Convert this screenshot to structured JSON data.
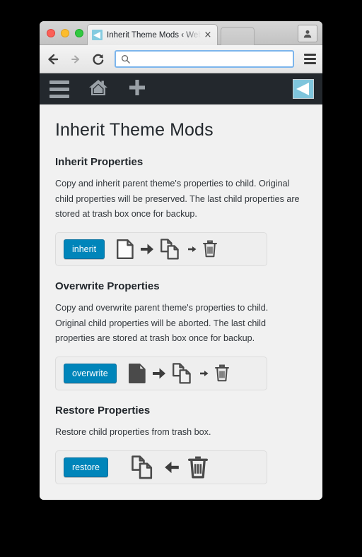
{
  "window": {
    "traffic_lights": [
      "close",
      "minimize",
      "maximize"
    ],
    "tab": {
      "title": "Inherit Theme Mods ‹ Webs",
      "close_label": "×",
      "favicon": "wordpress-site-icon"
    },
    "nav": {
      "back_label": "back",
      "forward_label": "forward",
      "reload_label": "reload",
      "menu_label": "chrome-menu"
    },
    "omnibox": {
      "value": "",
      "placeholder": "",
      "icon": "search-icon"
    },
    "profile_label": "profile"
  },
  "admin_bar": {
    "menu_label": "menu",
    "home_label": "home",
    "new_label": "new",
    "logo_label": "site-logo"
  },
  "page": {
    "title": "Inherit Theme Mods",
    "sections": [
      {
        "heading": "Inherit Properties",
        "description": "Copy and inherit parent theme's properties to child. Original child properties will be preserved. The last child properties are stored at trash box once for backup.",
        "button_label": "inherit",
        "flow": [
          "page-outline-icon",
          "arrow-right-icon",
          "pages-stack-icon",
          "arrow-right-small-icon",
          "trash-icon"
        ]
      },
      {
        "heading": "Overwrite Properties",
        "description": "Copy and overwrite parent theme's properties to child. Original child properties will be aborted. The last child properties are stored at trash box once for backup.",
        "button_label": "overwrite",
        "flow": [
          "page-filled-icon",
          "arrow-right-icon",
          "pages-stack-icon",
          "arrow-right-small-icon",
          "trash-icon"
        ]
      },
      {
        "heading": "Restore Properties",
        "description": "Restore child properties from trash box.",
        "button_label": "restore",
        "flow": [
          "pages-stack-icon",
          "arrow-left-icon",
          "trash-large-icon"
        ]
      }
    ]
  },
  "colors": {
    "accent_blue": "#0085ba",
    "admin_bar_bg": "#23282d",
    "page_bg": "#f1f1f1",
    "card_bg": "#eeeeee",
    "icon_stroke": "#4a4a4a"
  }
}
